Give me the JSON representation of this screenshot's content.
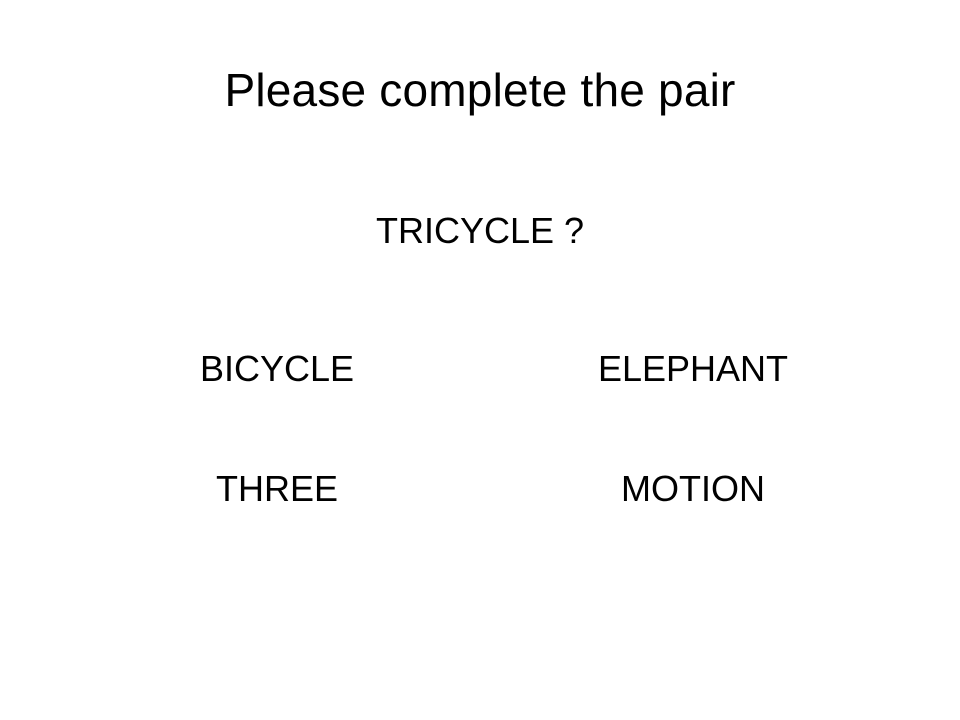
{
  "slide": {
    "title": "Please complete the pair",
    "prompt": "TRICYCLE ?",
    "options": [
      {
        "label": "BICYCLE"
      },
      {
        "label": "ELEPHANT"
      },
      {
        "label": "THREE"
      },
      {
        "label": "MOTION"
      }
    ]
  },
  "colors": {
    "background": "#ffffff",
    "text": "#000000"
  }
}
